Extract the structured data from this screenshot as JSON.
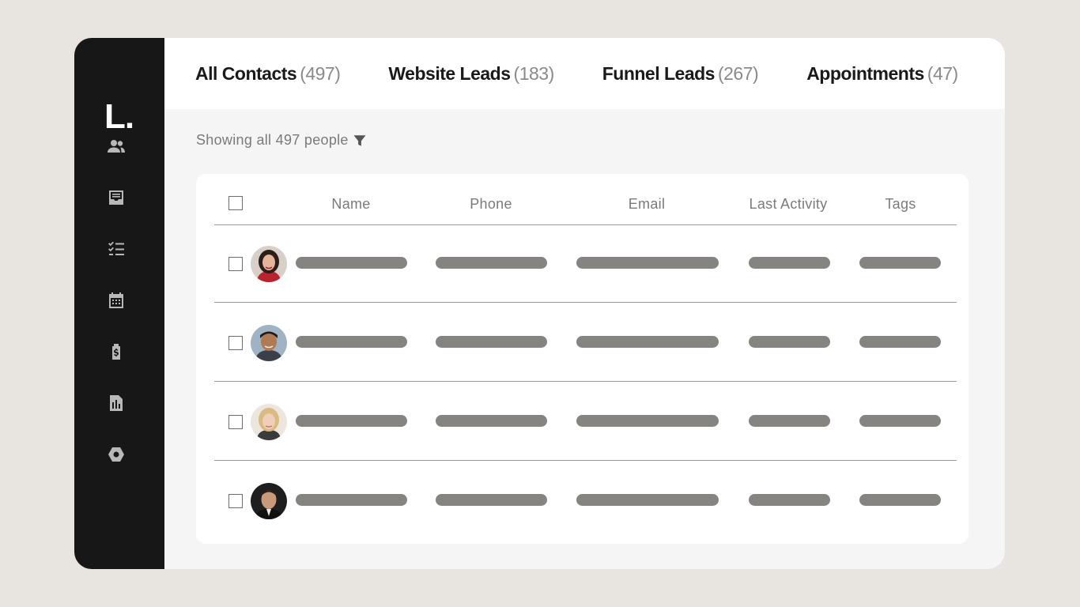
{
  "app": {
    "logo": "L."
  },
  "sidebar": {
    "items": [
      {
        "icon": "contacts-icon"
      },
      {
        "icon": "inbox-icon"
      },
      {
        "icon": "checklist-icon"
      },
      {
        "icon": "calendar-icon"
      },
      {
        "icon": "payments-icon"
      },
      {
        "icon": "reports-icon"
      },
      {
        "icon": "settings-icon"
      }
    ]
  },
  "tabs": [
    {
      "label": "All Contacts",
      "count": "(497)"
    },
    {
      "label": "Website Leads",
      "count": "(183)"
    },
    {
      "label": "Funnel Leads",
      "count": "(267)"
    },
    {
      "label": "Appointments",
      "count": "(47)"
    }
  ],
  "summary": {
    "text": "Showing all 497 people"
  },
  "table": {
    "columns": [
      "Name",
      "Phone",
      "Email",
      "Last Activity",
      "Tags"
    ],
    "rows": [
      {
        "avatar": "woman-dark-hair"
      },
      {
        "avatar": "man-dark-hair"
      },
      {
        "avatar": "woman-blonde"
      },
      {
        "avatar": "man-suit"
      }
    ]
  },
  "colors": {
    "background": "#e8e4df",
    "sidebar": "#171717",
    "placeholder_bar": "#858480"
  }
}
